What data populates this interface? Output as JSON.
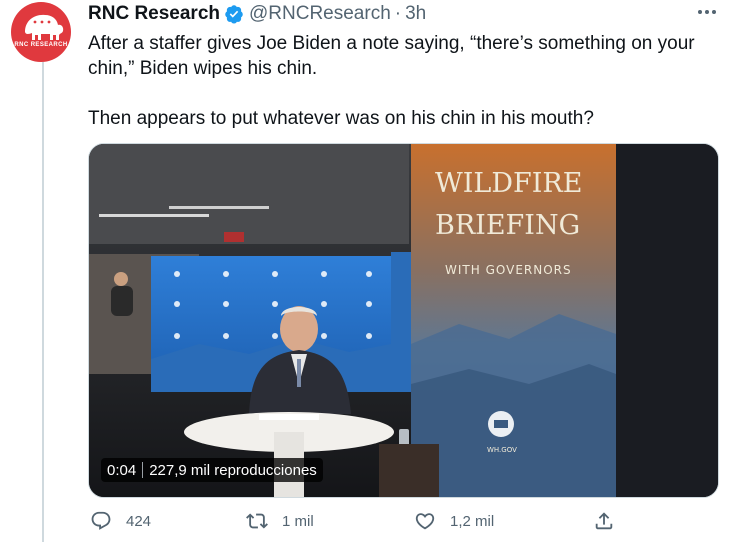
{
  "tweet": {
    "author": {
      "name": "RNC Research",
      "handle": "@RNCResearch",
      "verified": true,
      "avatar_text": "RNC RESEARCH"
    },
    "separator": "·",
    "time": "3h",
    "text_line1": "After a staffer gives Joe Biden a note saying, “there’s something on your chin,” Biden wipes his chin.",
    "text_line2": "Then appears to put whatever was on his chin in his mouth?",
    "media": {
      "type": "video",
      "duration": "0:04",
      "views": "227,9 mil reproducciones",
      "banner_line1": "WILDFIRE",
      "banner_line2": "BRIEFING",
      "banner_line3": "WITH GOVERNORS",
      "seal_text": "WH.GOV"
    },
    "actions": {
      "replies": "424",
      "retweets": "1 mil",
      "likes": "1,2 mil"
    }
  },
  "colors": {
    "text_primary": "#0f1419",
    "text_secondary": "#536471",
    "verified": "#1d9bf0",
    "avatar_bg": "#e0393e",
    "border": "#cfd9de"
  }
}
